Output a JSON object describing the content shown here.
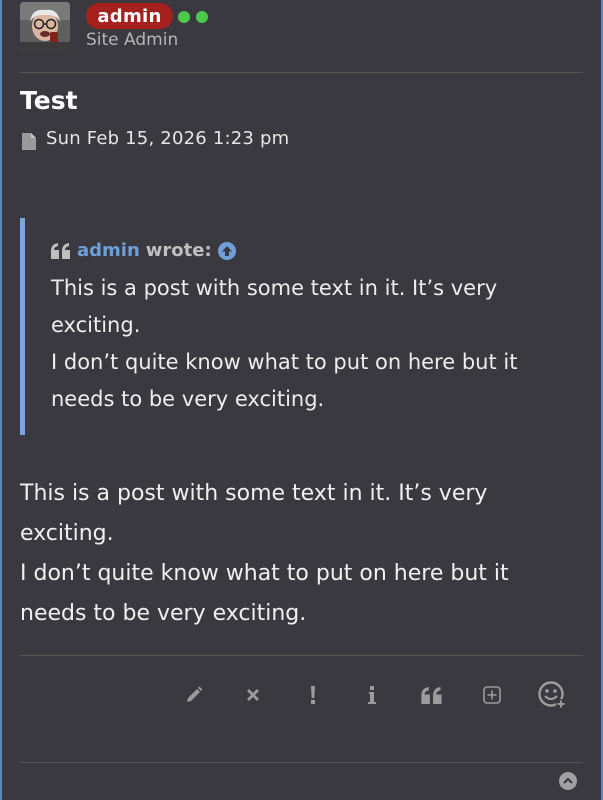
{
  "post": {
    "author": {
      "username": "admin",
      "rank": "Site Admin",
      "online": true,
      "colors": {
        "badge": "#a4211d",
        "online": "#4cc94c"
      }
    },
    "title": "Test",
    "date": "Sun Feb 15, 2026 1:23 pm",
    "quote": {
      "author": "admin",
      "wrote_label": "wrote:",
      "lines": [
        "This is a post with some text in it. It’s very exciting.",
        "I don’t quite know what to put on here but it needs to be very exciting."
      ]
    },
    "body": {
      "lines": [
        "This is a post with some text in it. It’s very exciting.",
        "I don’t quite know what to put on here but it needs to be very exciting."
      ]
    },
    "actions": {
      "edit": "edit-icon",
      "delete": "delete-icon",
      "report": "report-icon",
      "info": "info-icon",
      "quote": "quote-icon",
      "multiquote": "plus-square-icon",
      "reaction": "smiley-add-icon"
    }
  },
  "accent_color": "#5a86c4"
}
